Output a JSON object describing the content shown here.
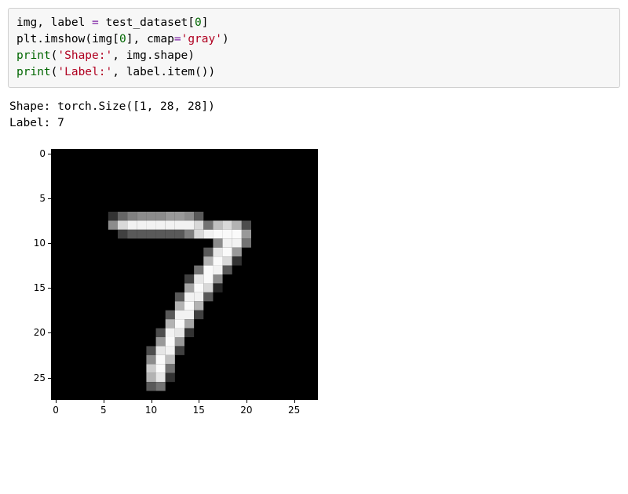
{
  "code": {
    "line1": {
      "lhs1": "img",
      "comma": ", ",
      "lhs2": "label",
      "eq": " = ",
      "rhs": "test_dataset",
      "lbrack": "[",
      "idx": "0",
      "rbrack": "]"
    },
    "line2": {
      "obj": "plt",
      "dot": ".",
      "fn": "imshow",
      "lp": "(",
      "arg1": "img",
      "lbrack": "[",
      "idx": "0",
      "rbrack": "]",
      "comma": ", ",
      "kw": "cmap",
      "eq": "=",
      "val": "'gray'",
      "rp": ")"
    },
    "line3": {
      "fn": "print",
      "lp": "(",
      "str": "'Shape:'",
      "comma": ", ",
      "arg": "img",
      "dot": ".",
      "attr": "shape",
      "rp": ")"
    },
    "line4": {
      "fn": "print",
      "lp": "(",
      "str": "'Label:'",
      "comma": ", ",
      "arg": "label",
      "dot": ".",
      "attr": "item",
      "call": "()",
      "rp": ")"
    }
  },
  "output": {
    "line1": "Shape: torch.Size([1, 28, 28])",
    "line2": "Label: 7"
  },
  "chart_data": {
    "type": "heatmap",
    "title": "",
    "xlabel": "",
    "ylabel": "",
    "xlim": [
      -0.5,
      27.5
    ],
    "ylim": [
      27.5,
      -0.5
    ],
    "xticks": [
      0,
      5,
      10,
      15,
      20,
      25
    ],
    "yticks": [
      0,
      5,
      10,
      15,
      20,
      25
    ],
    "cmap": "gray",
    "shape": [
      28,
      28
    ],
    "label_value": 7,
    "pixels": [
      {
        "r": 7,
        "c": 6,
        "v": 0.2
      },
      {
        "r": 7,
        "c": 7,
        "v": 0.4
      },
      {
        "r": 7,
        "c": 8,
        "v": 0.5
      },
      {
        "r": 7,
        "c": 9,
        "v": 0.55
      },
      {
        "r": 7,
        "c": 10,
        "v": 0.55
      },
      {
        "r": 7,
        "c": 11,
        "v": 0.55
      },
      {
        "r": 7,
        "c": 12,
        "v": 0.6
      },
      {
        "r": 7,
        "c": 13,
        "v": 0.6
      },
      {
        "r": 7,
        "c": 14,
        "v": 0.55
      },
      {
        "r": 7,
        "c": 15,
        "v": 0.35
      },
      {
        "r": 8,
        "c": 6,
        "v": 0.55
      },
      {
        "r": 8,
        "c": 7,
        "v": 0.85
      },
      {
        "r": 8,
        "c": 8,
        "v": 0.95
      },
      {
        "r": 8,
        "c": 9,
        "v": 0.95
      },
      {
        "r": 8,
        "c": 10,
        "v": 0.95
      },
      {
        "r": 8,
        "c": 11,
        "v": 0.95
      },
      {
        "r": 8,
        "c": 12,
        "v": 0.95
      },
      {
        "r": 8,
        "c": 13,
        "v": 0.95
      },
      {
        "r": 8,
        "c": 14,
        "v": 0.95
      },
      {
        "r": 8,
        "c": 15,
        "v": 0.85
      },
      {
        "r": 8,
        "c": 16,
        "v": 0.45
      },
      {
        "r": 8,
        "c": 17,
        "v": 0.75
      },
      {
        "r": 8,
        "c": 18,
        "v": 0.85
      },
      {
        "r": 8,
        "c": 19,
        "v": 0.7
      },
      {
        "r": 8,
        "c": 20,
        "v": 0.3
      },
      {
        "r": 9,
        "c": 7,
        "v": 0.25
      },
      {
        "r": 9,
        "c": 8,
        "v": 0.35
      },
      {
        "r": 9,
        "c": 9,
        "v": 0.35
      },
      {
        "r": 9,
        "c": 10,
        "v": 0.35
      },
      {
        "r": 9,
        "c": 11,
        "v": 0.35
      },
      {
        "r": 9,
        "c": 12,
        "v": 0.35
      },
      {
        "r": 9,
        "c": 13,
        "v": 0.35
      },
      {
        "r": 9,
        "c": 14,
        "v": 0.5
      },
      {
        "r": 9,
        "c": 15,
        "v": 0.85
      },
      {
        "r": 9,
        "c": 16,
        "v": 0.95
      },
      {
        "r": 9,
        "c": 17,
        "v": 0.98
      },
      {
        "r": 9,
        "c": 18,
        "v": 0.98
      },
      {
        "r": 9,
        "c": 19,
        "v": 0.98
      },
      {
        "r": 9,
        "c": 20,
        "v": 0.6
      },
      {
        "r": 10,
        "c": 17,
        "v": 0.55
      },
      {
        "r": 10,
        "c": 18,
        "v": 0.95
      },
      {
        "r": 10,
        "c": 19,
        "v": 0.95
      },
      {
        "r": 10,
        "c": 20,
        "v": 0.45
      },
      {
        "r": 11,
        "c": 16,
        "v": 0.35
      },
      {
        "r": 11,
        "c": 17,
        "v": 0.9
      },
      {
        "r": 11,
        "c": 18,
        "v": 0.98
      },
      {
        "r": 11,
        "c": 19,
        "v": 0.6
      },
      {
        "r": 12,
        "c": 16,
        "v": 0.7
      },
      {
        "r": 12,
        "c": 17,
        "v": 0.98
      },
      {
        "r": 12,
        "c": 18,
        "v": 0.85
      },
      {
        "r": 12,
        "c": 19,
        "v": 0.2
      },
      {
        "r": 13,
        "c": 15,
        "v": 0.45
      },
      {
        "r": 13,
        "c": 16,
        "v": 0.98
      },
      {
        "r": 13,
        "c": 17,
        "v": 0.95
      },
      {
        "r": 13,
        "c": 18,
        "v": 0.35
      },
      {
        "r": 14,
        "c": 14,
        "v": 0.25
      },
      {
        "r": 14,
        "c": 15,
        "v": 0.9
      },
      {
        "r": 14,
        "c": 16,
        "v": 0.98
      },
      {
        "r": 14,
        "c": 17,
        "v": 0.55
      },
      {
        "r": 15,
        "c": 14,
        "v": 0.65
      },
      {
        "r": 15,
        "c": 15,
        "v": 0.98
      },
      {
        "r": 15,
        "c": 16,
        "v": 0.85
      },
      {
        "r": 15,
        "c": 17,
        "v": 0.15
      },
      {
        "r": 16,
        "c": 13,
        "v": 0.35
      },
      {
        "r": 16,
        "c": 14,
        "v": 0.95
      },
      {
        "r": 16,
        "c": 15,
        "v": 0.95
      },
      {
        "r": 16,
        "c": 16,
        "v": 0.35
      },
      {
        "r": 17,
        "c": 13,
        "v": 0.7
      },
      {
        "r": 17,
        "c": 14,
        "v": 0.98
      },
      {
        "r": 17,
        "c": 15,
        "v": 0.7
      },
      {
        "r": 18,
        "c": 12,
        "v": 0.35
      },
      {
        "r": 18,
        "c": 13,
        "v": 0.95
      },
      {
        "r": 18,
        "c": 14,
        "v": 0.95
      },
      {
        "r": 18,
        "c": 15,
        "v": 0.25
      },
      {
        "r": 19,
        "c": 12,
        "v": 0.7
      },
      {
        "r": 19,
        "c": 13,
        "v": 0.98
      },
      {
        "r": 19,
        "c": 14,
        "v": 0.65
      },
      {
        "r": 20,
        "c": 11,
        "v": 0.3
      },
      {
        "r": 20,
        "c": 12,
        "v": 0.95
      },
      {
        "r": 20,
        "c": 13,
        "v": 0.9
      },
      {
        "r": 20,
        "c": 14,
        "v": 0.2
      },
      {
        "r": 21,
        "c": 11,
        "v": 0.6
      },
      {
        "r": 21,
        "c": 12,
        "v": 0.98
      },
      {
        "r": 21,
        "c": 13,
        "v": 0.6
      },
      {
        "r": 22,
        "c": 10,
        "v": 0.3
      },
      {
        "r": 22,
        "c": 11,
        "v": 0.9
      },
      {
        "r": 22,
        "c": 12,
        "v": 0.95
      },
      {
        "r": 22,
        "c": 13,
        "v": 0.25
      },
      {
        "r": 23,
        "c": 10,
        "v": 0.55
      },
      {
        "r": 23,
        "c": 11,
        "v": 0.98
      },
      {
        "r": 23,
        "c": 12,
        "v": 0.75
      },
      {
        "r": 24,
        "c": 10,
        "v": 0.8
      },
      {
        "r": 24,
        "c": 11,
        "v": 0.98
      },
      {
        "r": 24,
        "c": 12,
        "v": 0.45
      },
      {
        "r": 25,
        "c": 10,
        "v": 0.7
      },
      {
        "r": 25,
        "c": 11,
        "v": 0.9
      },
      {
        "r": 25,
        "c": 12,
        "v": 0.2
      },
      {
        "r": 26,
        "c": 10,
        "v": 0.35
      },
      {
        "r": 26,
        "c": 11,
        "v": 0.45
      }
    ]
  }
}
